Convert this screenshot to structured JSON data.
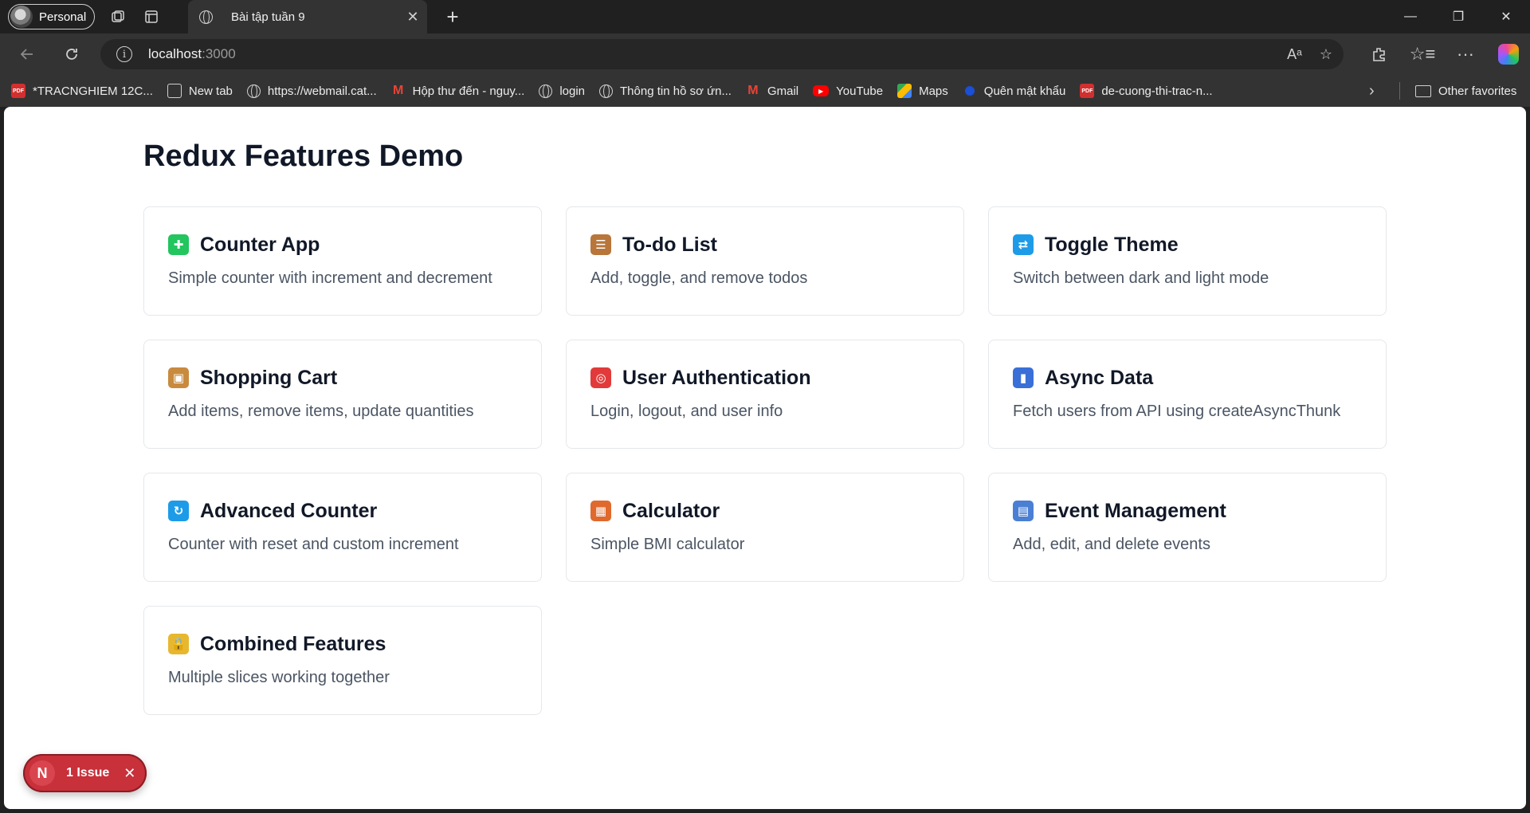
{
  "browser": {
    "profile_label": "Personal",
    "tab_title": "Bài tập tuần 9",
    "tab_close": "✕",
    "new_tab": "+",
    "window_controls": {
      "minimize": "—",
      "restore": "❐",
      "close": "✕"
    },
    "address": {
      "host": "localhost",
      "port": ":3000",
      "info_icon": "i"
    },
    "bookmarks": [
      {
        "label": "*TRACNGHIEM 12C...",
        "icon": "pdf-icon"
      },
      {
        "label": "New tab",
        "icon": "new-tab-icon"
      },
      {
        "label": "https://webmail.cat...",
        "icon": "globe-icon"
      },
      {
        "label": "Hộp thư đến - nguy...",
        "icon": "gmail-icon"
      },
      {
        "label": "login",
        "icon": "globe-icon"
      },
      {
        "label": "Thông tin hồ sơ ứn...",
        "icon": "globe-icon"
      },
      {
        "label": "Gmail",
        "icon": "gmail-icon"
      },
      {
        "label": "YouTube",
        "icon": "youtube-icon"
      },
      {
        "label": "Maps",
        "icon": "maps-icon"
      },
      {
        "label": "Quên mật khẩu",
        "icon": "site-icon"
      },
      {
        "label": "de-cuong-thi-trac-n...",
        "icon": "pdf-icon"
      }
    ],
    "bookmarks_more": "›",
    "other_favorites": "Other favorites"
  },
  "page": {
    "title": "Redux Features Demo",
    "cards": [
      {
        "title": "Counter App",
        "desc": "Simple counter with increment and decrement",
        "icon": "puzzle-icon",
        "color": "#22c55e",
        "glyph": "✚"
      },
      {
        "title": "To-do List",
        "desc": "Add, toggle, and remove todos",
        "icon": "clipboard-icon",
        "color": "#b8763a",
        "glyph": "☰"
      },
      {
        "title": "Toggle Theme",
        "desc": "Switch between dark and light mode",
        "icon": "repeat-icon",
        "color": "#1e9be8",
        "glyph": "⇄"
      },
      {
        "title": "Shopping Cart",
        "desc": "Add items, remove items, update quantities",
        "icon": "package-icon",
        "color": "#c88a3e",
        "glyph": "▣"
      },
      {
        "title": "User Authentication",
        "desc": "Login, logout, and user info",
        "icon": "target-icon",
        "color": "#e23a3a",
        "glyph": "◎"
      },
      {
        "title": "Async Data",
        "desc": "Fetch users from API using createAsyncThunk",
        "icon": "bar-chart-icon",
        "color": "#3a6fd8",
        "glyph": "▮"
      },
      {
        "title": "Advanced Counter",
        "desc": "Counter with reset and custom increment",
        "icon": "refresh-icon",
        "color": "#1e9be8",
        "glyph": "↻"
      },
      {
        "title": "Calculator",
        "desc": "Simple BMI calculator",
        "icon": "abacus-icon",
        "color": "#e0692e",
        "glyph": "▦"
      },
      {
        "title": "Event Management",
        "desc": "Add, edit, and delete events",
        "icon": "calendar-icon",
        "color": "#4a7fd4",
        "glyph": "▤"
      },
      {
        "title": "Combined Features",
        "desc": "Multiple slices working together",
        "icon": "lock-icon",
        "color": "#e8b730",
        "glyph": "🔒"
      }
    ]
  },
  "issue_badge": {
    "logo": "N",
    "count_label": "1 Issue",
    "close": "✕"
  }
}
